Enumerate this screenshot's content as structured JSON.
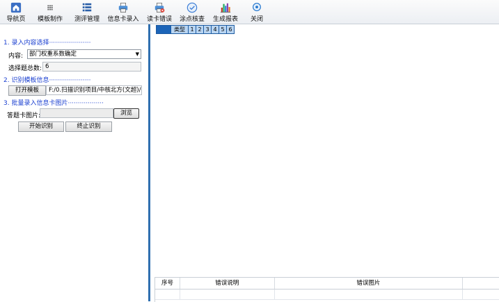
{
  "toolbar": {
    "items": [
      {
        "label": "导航页",
        "icon": "home-icon"
      },
      {
        "label": "模板制作",
        "icon": "grid-dots-icon"
      },
      {
        "label": "测评管理",
        "icon": "list-icon"
      },
      {
        "label": "信息卡录入",
        "icon": "printer-icon"
      },
      {
        "label": "读卡错误",
        "icon": "printer-error-icon"
      },
      {
        "label": "涂点核查",
        "icon": "check-circle-icon"
      },
      {
        "label": "生成报表",
        "icon": "bar-chart-icon"
      },
      {
        "label": "关闭",
        "icon": "close-circle-icon"
      }
    ]
  },
  "left_panel": {
    "section1_title": "1. 录入内容选择",
    "content_label": "内容:",
    "content_value": "部门权重系数确定",
    "total_label": "选择题总数:",
    "total_value": "6",
    "section2_title": "2. 识别模板信息",
    "open_template_label": "打开模板",
    "template_path": "F:/0.扫描识别项目/中核北方(文超)/Ol",
    "section3_title": "3. 批量录入信息卡图片",
    "card_image_label": "答题卡图片:",
    "card_image_value": "",
    "browse_label": "浏览",
    "start_label": "开始识别",
    "stop_label": "终止识别"
  },
  "grid": {
    "columns": [
      "类型",
      "1",
      "2",
      "3",
      "4",
      "5",
      "6"
    ]
  },
  "error_table": {
    "columns": [
      "序号",
      "错误说明",
      "错误图片"
    ]
  },
  "colors": {
    "accent": "#2f6fb0",
    "section_title": "#1a3fd0",
    "grid_header": "#b9d5f2"
  }
}
